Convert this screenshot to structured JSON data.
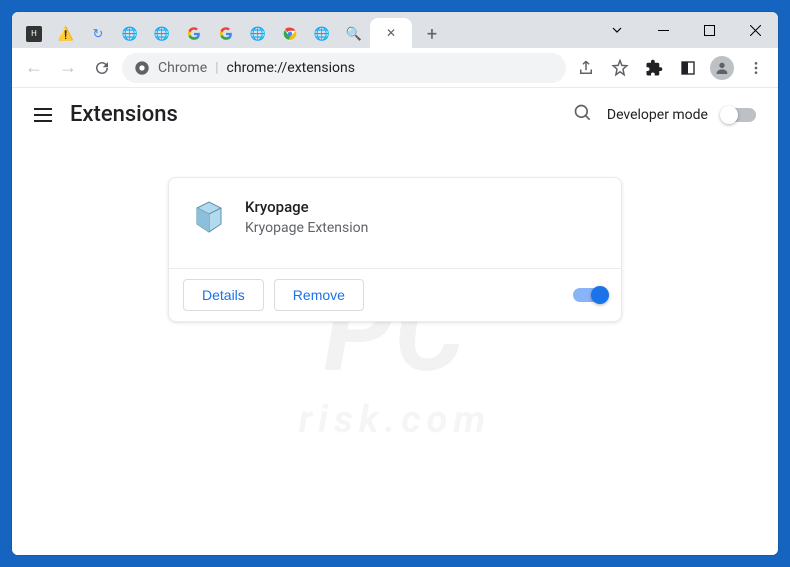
{
  "window": {
    "minimize_label": "Minimize",
    "maximize_label": "Maximize",
    "close_label": "Close"
  },
  "tabs": {
    "new_tab_label": "+"
  },
  "addressbar": {
    "scheme_label": "Chrome",
    "url_path": "chrome://extensions"
  },
  "page": {
    "title": "Extensions",
    "developer_mode_label": "Developer mode",
    "developer_mode_on": false
  },
  "extension": {
    "name": "Kryopage",
    "description": "Kryopage Extension",
    "details_label": "Details",
    "remove_label": "Remove",
    "enabled": true
  },
  "watermark": {
    "main": "PC",
    "sub": "risk.com"
  }
}
